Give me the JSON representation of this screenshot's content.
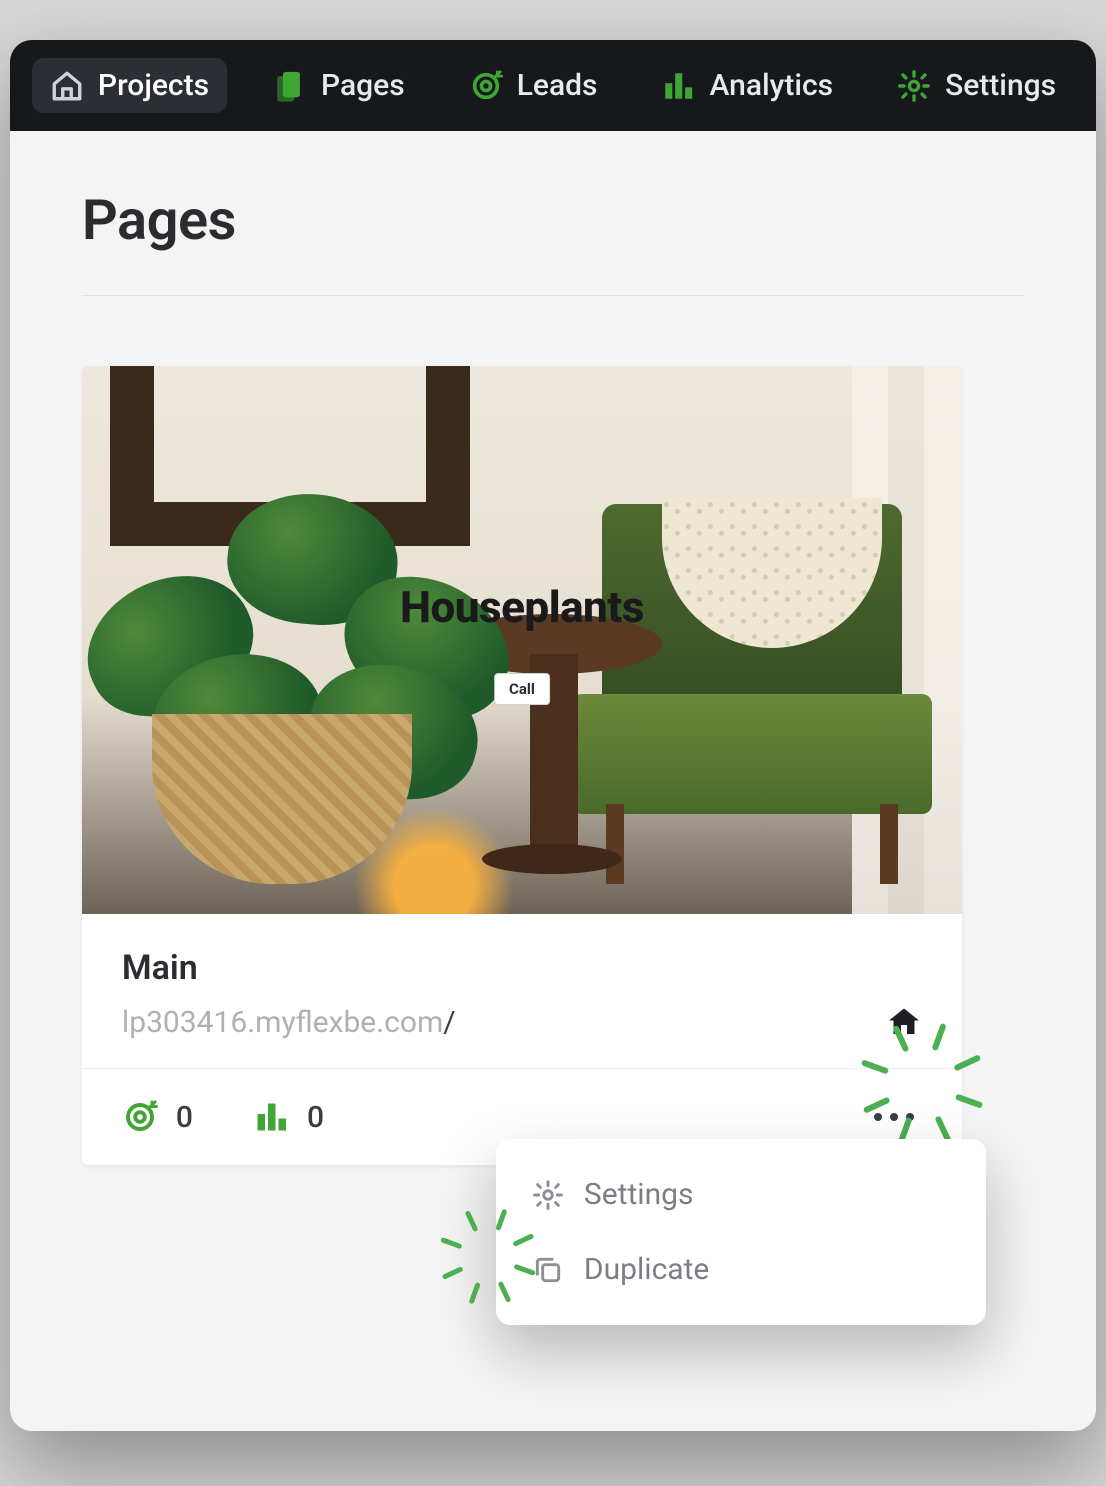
{
  "nav": {
    "projects": "Projects",
    "pages": "Pages",
    "leads": "Leads",
    "analytics": "Analytics",
    "settings": "Settings"
  },
  "page": {
    "title": "Pages"
  },
  "card": {
    "thumb_title": "Houseplants",
    "thumb_cta": "Call",
    "title": "Main",
    "url_host": "lp303416.myflexbe.com",
    "url_path": "/",
    "leads_count": "0",
    "analytics_count": "0"
  },
  "menu": {
    "settings": "Settings",
    "duplicate": "Duplicate"
  }
}
